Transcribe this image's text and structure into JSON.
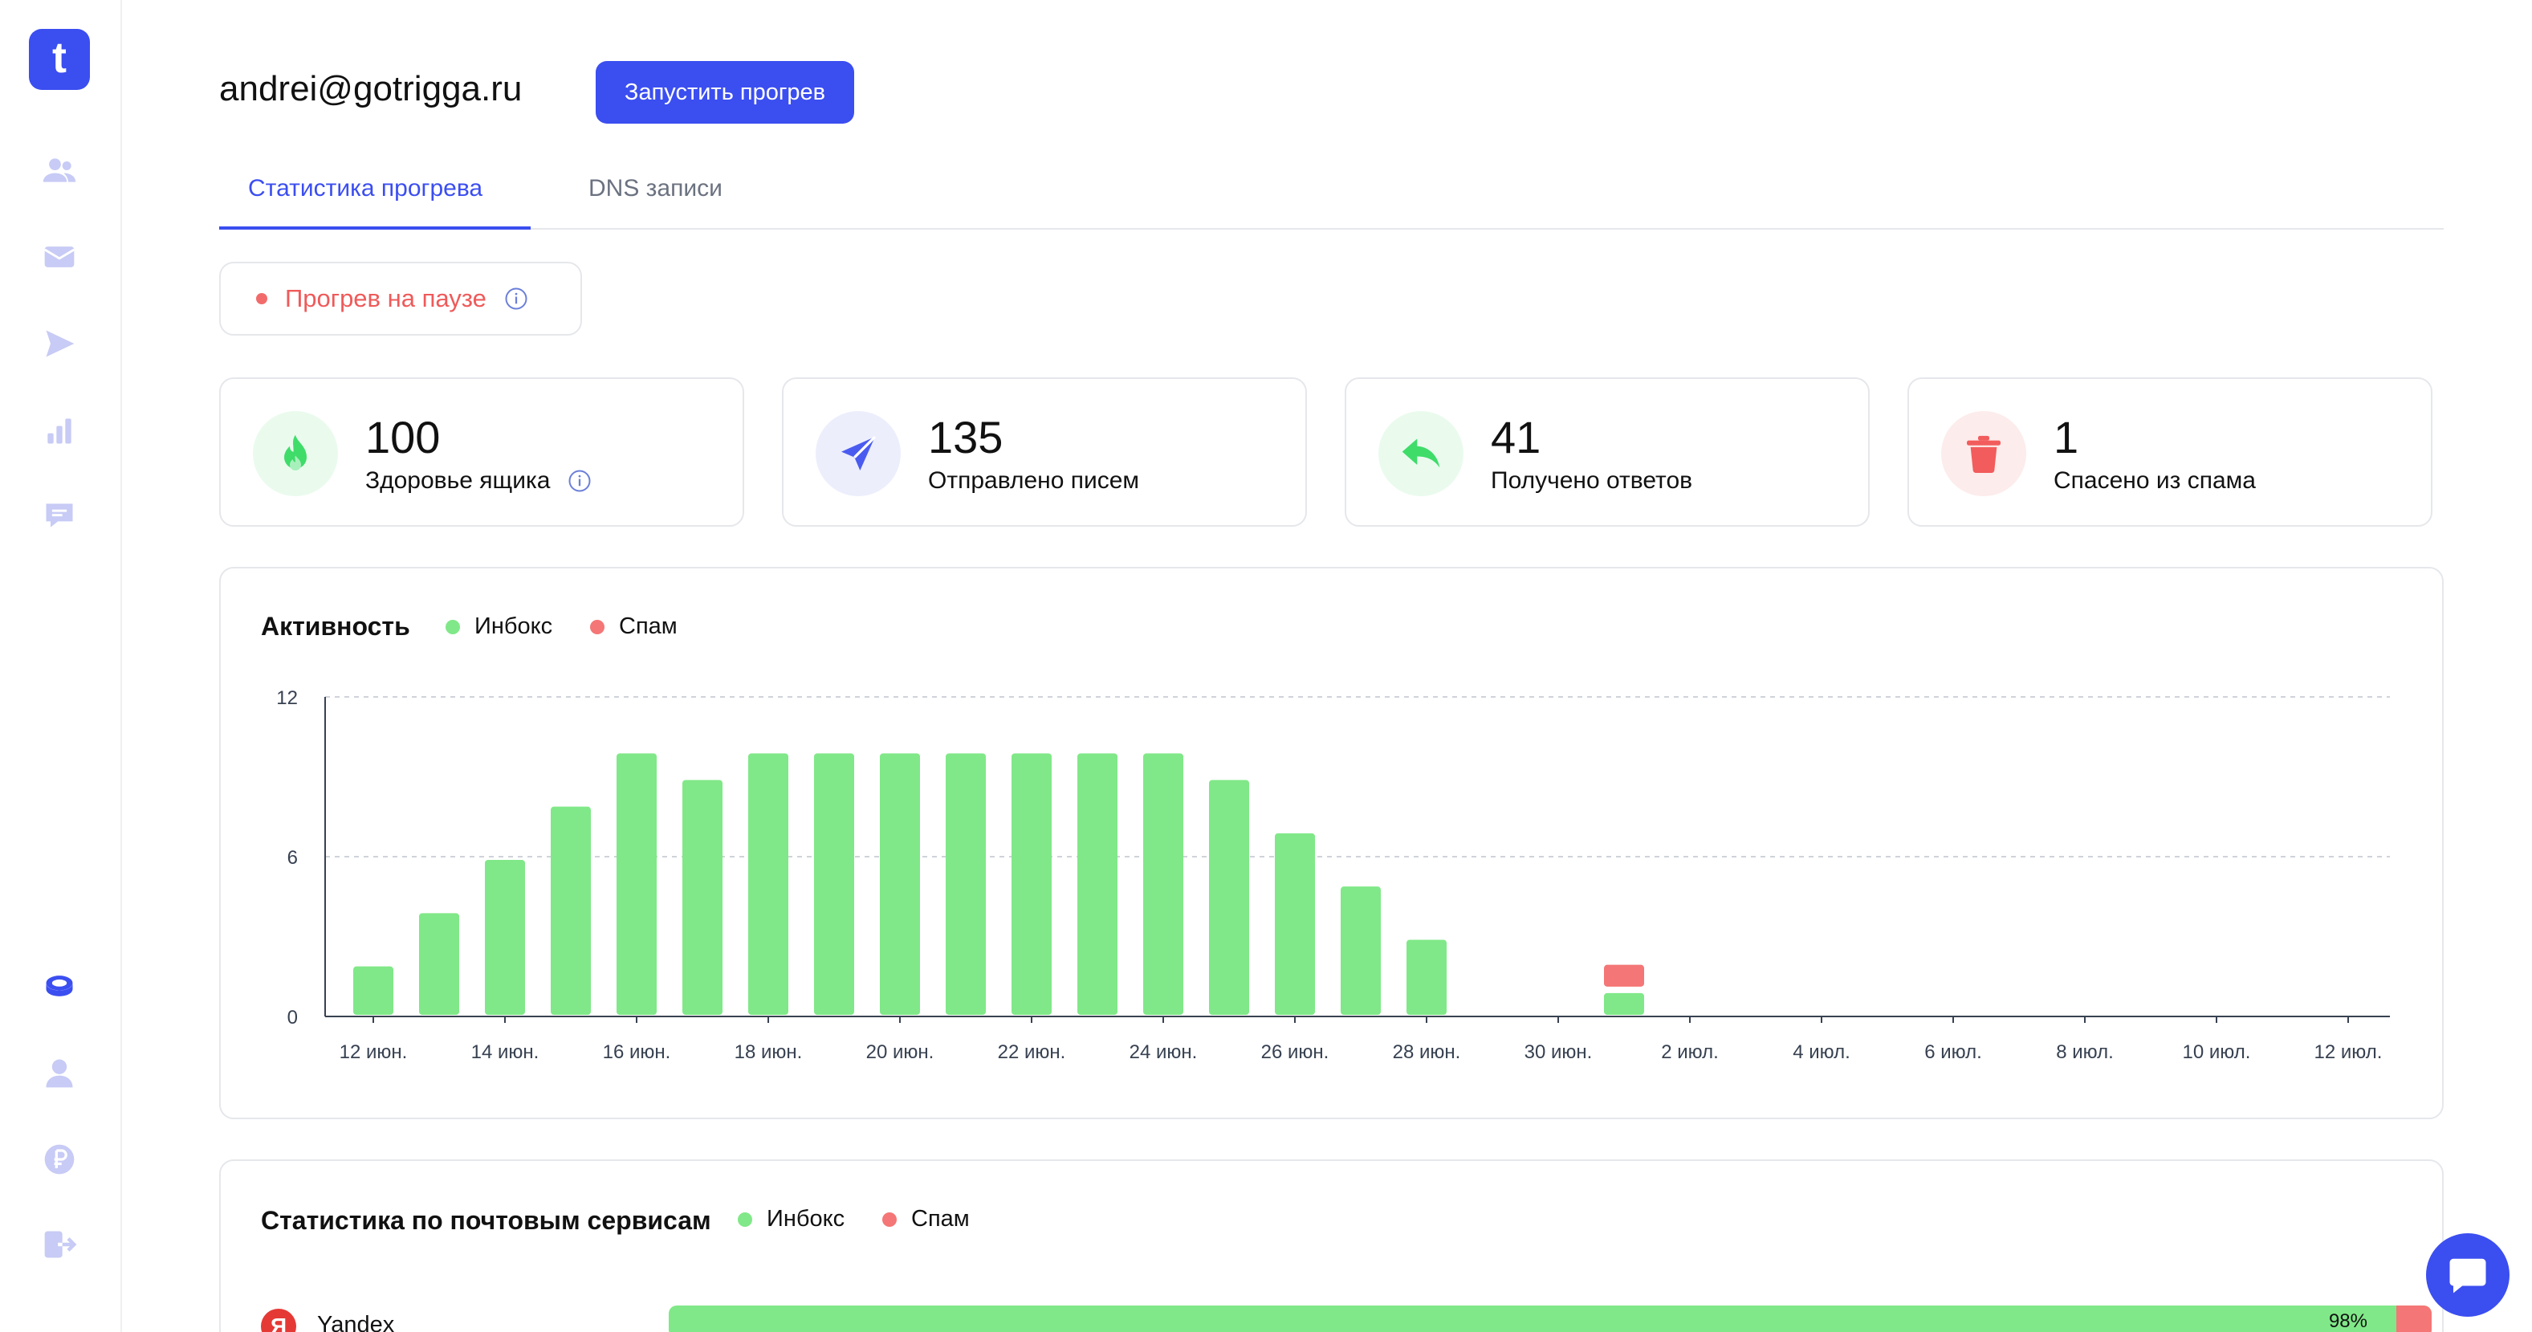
{
  "app": {
    "logo_letter": "t"
  },
  "sidebar": {
    "items": [
      {
        "name": "users-icon"
      },
      {
        "name": "mail-icon"
      },
      {
        "name": "send-icon"
      },
      {
        "name": "bar-chart-icon"
      },
      {
        "name": "chat-icon"
      }
    ],
    "bottom_items": [
      {
        "name": "coins-icon"
      },
      {
        "name": "user-icon"
      },
      {
        "name": "ruble-icon"
      },
      {
        "name": "logout-icon"
      }
    ]
  },
  "header": {
    "email": "andrei@gotrigga.ru",
    "start_button": "Запустить прогрев"
  },
  "tabs": [
    {
      "label": "Статистика прогрева",
      "active": true
    },
    {
      "label": "DNS записи",
      "active": false
    }
  ],
  "status": {
    "text": "Прогрев на паузе",
    "color": "#ef5a5a"
  },
  "stats": [
    {
      "value": "100",
      "label": "Здоровье ящика",
      "icon": "fire-icon",
      "bg": "#eafbee",
      "color": "#3fdc6a",
      "info": true
    },
    {
      "value": "135",
      "label": "Отправлено писем",
      "icon": "send-icon",
      "bg": "#eceefc",
      "color": "#4a5cf0",
      "info": false
    },
    {
      "value": "41",
      "label": "Получено ответов",
      "icon": "reply-icon",
      "bg": "#eafbee",
      "color": "#3fdc6a",
      "info": false
    },
    {
      "value": "1",
      "label": "Спасено из спама",
      "icon": "trash-icon",
      "bg": "#fdecec",
      "color": "#f25c5c",
      "info": false
    }
  ],
  "activity": {
    "title": "Активность",
    "legend": {
      "inbox": "Инбокс",
      "spam": "Спам"
    }
  },
  "providers": {
    "title": "Статистика по почтовым сервисам",
    "legend": {
      "inbox": "Инбокс",
      "spam": "Спам"
    },
    "rows": [
      {
        "name": "Yandex",
        "inbox_pct": 98,
        "label": "98%"
      }
    ]
  },
  "colors": {
    "accent": "#3b4ef0",
    "inbox": "#80e888",
    "spam": "#f47676"
  },
  "chart_data": {
    "type": "bar",
    "title": "Активность",
    "ylim": [
      0,
      12
    ],
    "yticks": [
      0,
      6,
      12
    ],
    "x": [
      "12 июн.",
      "13 июн.",
      "14 июн.",
      "15 июн.",
      "16 июн.",
      "17 июн.",
      "18 июн.",
      "19 июн.",
      "20 июн.",
      "21 июн.",
      "22 июн.",
      "23 июн.",
      "24 июн.",
      "25 июн.",
      "26 июн.",
      "27 июн.",
      "28 июн.",
      "29 июн.",
      "30 июн.",
      "1 июл.",
      "2 июл.",
      "3 июл.",
      "4 июл.",
      "5 июл.",
      "6 июл.",
      "7 июл.",
      "8 июл.",
      "9 июл.",
      "10 июл.",
      "11 июл.",
      "12 июл."
    ],
    "xtick_labels": [
      "12 июн.",
      "14 июн.",
      "16 июн.",
      "18 июн.",
      "20 июн.",
      "22 июн.",
      "24 июн.",
      "26 июн.",
      "28 июн.",
      "30 июн.",
      "2 июл.",
      "4 июл.",
      "6 июл.",
      "8 июл.",
      "10 июл.",
      "12 июл."
    ],
    "series": [
      {
        "name": "Инбокс",
        "color": "#80e888",
        "values": [
          2,
          4,
          6,
          8,
          10,
          9,
          10,
          10,
          10,
          10,
          10,
          10,
          10,
          9,
          7,
          5,
          3,
          0,
          0,
          1,
          0,
          0,
          0,
          0,
          0,
          0,
          0,
          0,
          0,
          0,
          0
        ]
      },
      {
        "name": "Спам",
        "color": "#f47676",
        "values": [
          0,
          0,
          0,
          0,
          0,
          0,
          0,
          0,
          0,
          0,
          0,
          0,
          0,
          0,
          0,
          0,
          0,
          0,
          0,
          1,
          0,
          0,
          0,
          0,
          0,
          0,
          0,
          0,
          0,
          0,
          0
        ]
      }
    ],
    "stacked": true,
    "grid": true
  }
}
